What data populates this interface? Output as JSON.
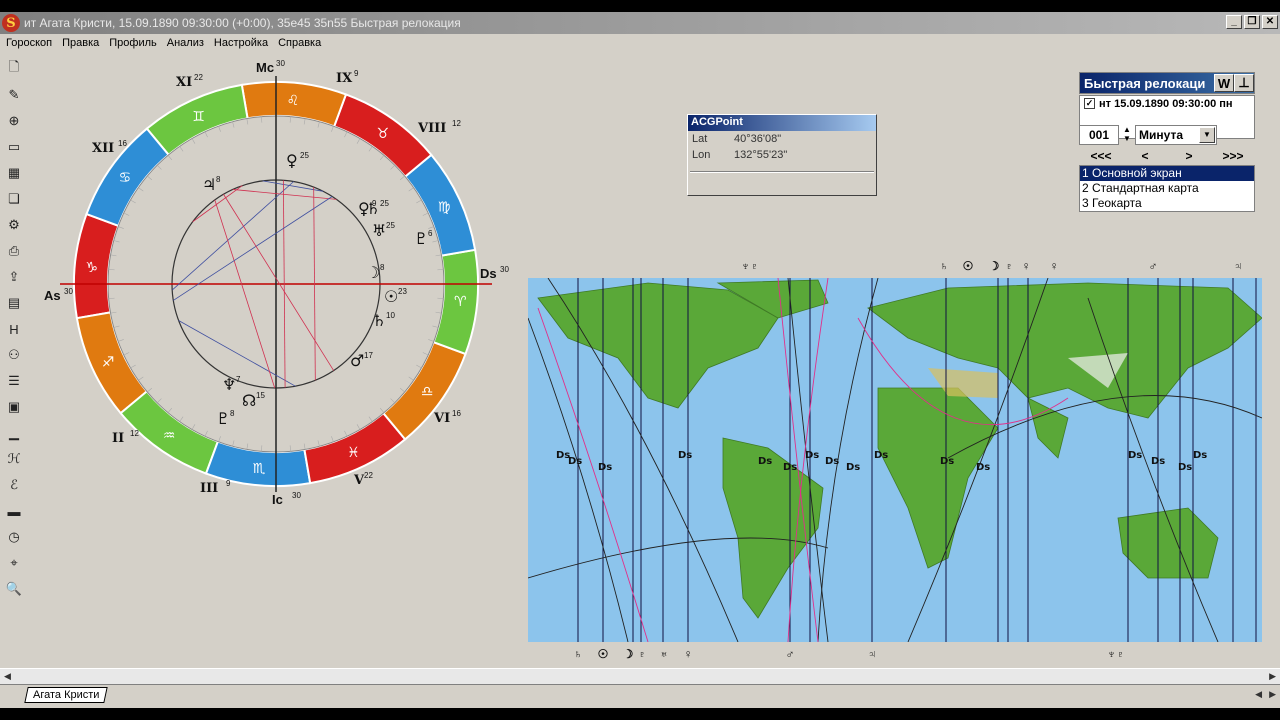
{
  "window": {
    "title": "ит Агата Кристи, 15.09.1890 09:30:00 (+0:00), 35e45 35n55 Быстрая релокация",
    "app_icon": "S",
    "buttons": [
      "_",
      "❐",
      "✕"
    ]
  },
  "menu": [
    "Гороскоп",
    "Правка",
    "Профиль",
    "Анализ",
    "Настройка",
    "Справка"
  ],
  "toolbar": [
    "new-document-icon",
    "edit-document-icon",
    "add-document-icon",
    "blank-document-icon",
    "image-icon",
    "copy-icon",
    "settings-icon",
    "print-icon",
    "export-icon",
    "table-icon",
    "letter-h-icon",
    "group-icon",
    "list-icon",
    "stack-icon",
    "bar-chart-icon",
    "italic-h-icon",
    "ec-icon",
    "folder-icon",
    "clock-icon",
    "map-icon",
    "zoom-icon"
  ],
  "chart": {
    "angles": {
      "mc": "Mc",
      "ic": "Ic",
      "as": "As",
      "ds": "Ds"
    },
    "angle_degrees": {
      "mc": "30",
      "ic": "30",
      "as": "30",
      "ds": "30"
    },
    "houses": [
      {
        "label": "XI",
        "deg": "22"
      },
      {
        "label": "IX",
        "deg": "9"
      },
      {
        "label": "XII",
        "deg": "16"
      },
      {
        "label": "VIII",
        "deg": "12"
      },
      {
        "label": "II",
        "deg": "12"
      },
      {
        "label": "VI",
        "deg": "16"
      },
      {
        "label": "III",
        "deg": "9"
      },
      {
        "label": "V",
        "deg": "22"
      }
    ],
    "signs": [
      "♑",
      "♐",
      "♒",
      "♏",
      "♓",
      "♎",
      "♈",
      "♍",
      "♉",
      "♌",
      "♊",
      "♋"
    ],
    "planets": [
      {
        "glyph": "♃",
        "deg": "8"
      },
      {
        "glyph": "♄",
        "deg": "25"
      },
      {
        "glyph": "♀",
        "deg": "9"
      },
      {
        "glyph": "♅",
        "deg": "25"
      },
      {
        "glyph": "♇",
        "deg": "6"
      },
      {
        "glyph": "☽",
        "deg": "8"
      },
      {
        "glyph": "☉",
        "deg": "23"
      },
      {
        "glyph": "♄",
        "deg": "10"
      },
      {
        "glyph": "♆",
        "deg": "7"
      },
      {
        "glyph": "☊",
        "deg": "15"
      },
      {
        "glyph": "♇",
        "deg": "8"
      },
      {
        "glyph": "♂",
        "deg": "17"
      },
      {
        "glyph": "♀",
        "deg": "25"
      }
    ]
  },
  "acg_point": {
    "title": "ACGPoint",
    "lat_label": "Lat",
    "lat_value": "40°36'08\"",
    "lon_label": "Lon",
    "lon_value": "132°55'23\""
  },
  "relocation": {
    "title": "Быстрая релокаци",
    "w_button": "W",
    "pin_button": "⊥",
    "entry": "нт 15.09.1890 09:30:00 пн",
    "entry_checked": true,
    "step_value": "001",
    "unit": "Минута",
    "nav": [
      "<<<",
      "<",
      ">",
      ">>>"
    ],
    "screens": [
      "1 Основной экран",
      "2 Стандартная карта",
      "3 Геокарта"
    ],
    "selected_screen": 0
  },
  "map": {
    "top_glyphs": [
      "♆♇",
      "♄",
      "☉",
      "☽",
      "♇",
      "♀",
      "♀",
      "♂",
      "♃"
    ],
    "bottom_glyphs": [
      "♄",
      "☉",
      "☽",
      "♇",
      "♅",
      "♀",
      "♂",
      "♃",
      "♆♇"
    ],
    "line_labels": [
      "Ds",
      "Ds",
      "Ds",
      "Ds",
      "Ds",
      "Ds",
      "Ds",
      "Ds",
      "Ds",
      "Ds",
      "Ds",
      "Ds",
      "Ds",
      "Ds",
      "Ds",
      "Ds"
    ]
  },
  "tabs": [
    "Агата Кристи"
  ],
  "colors": {
    "fire": "#d81e1e",
    "earth": "#e07a10",
    "air": "#6cc640",
    "water": "#2e8ed6",
    "title_active": "#0a246a"
  }
}
